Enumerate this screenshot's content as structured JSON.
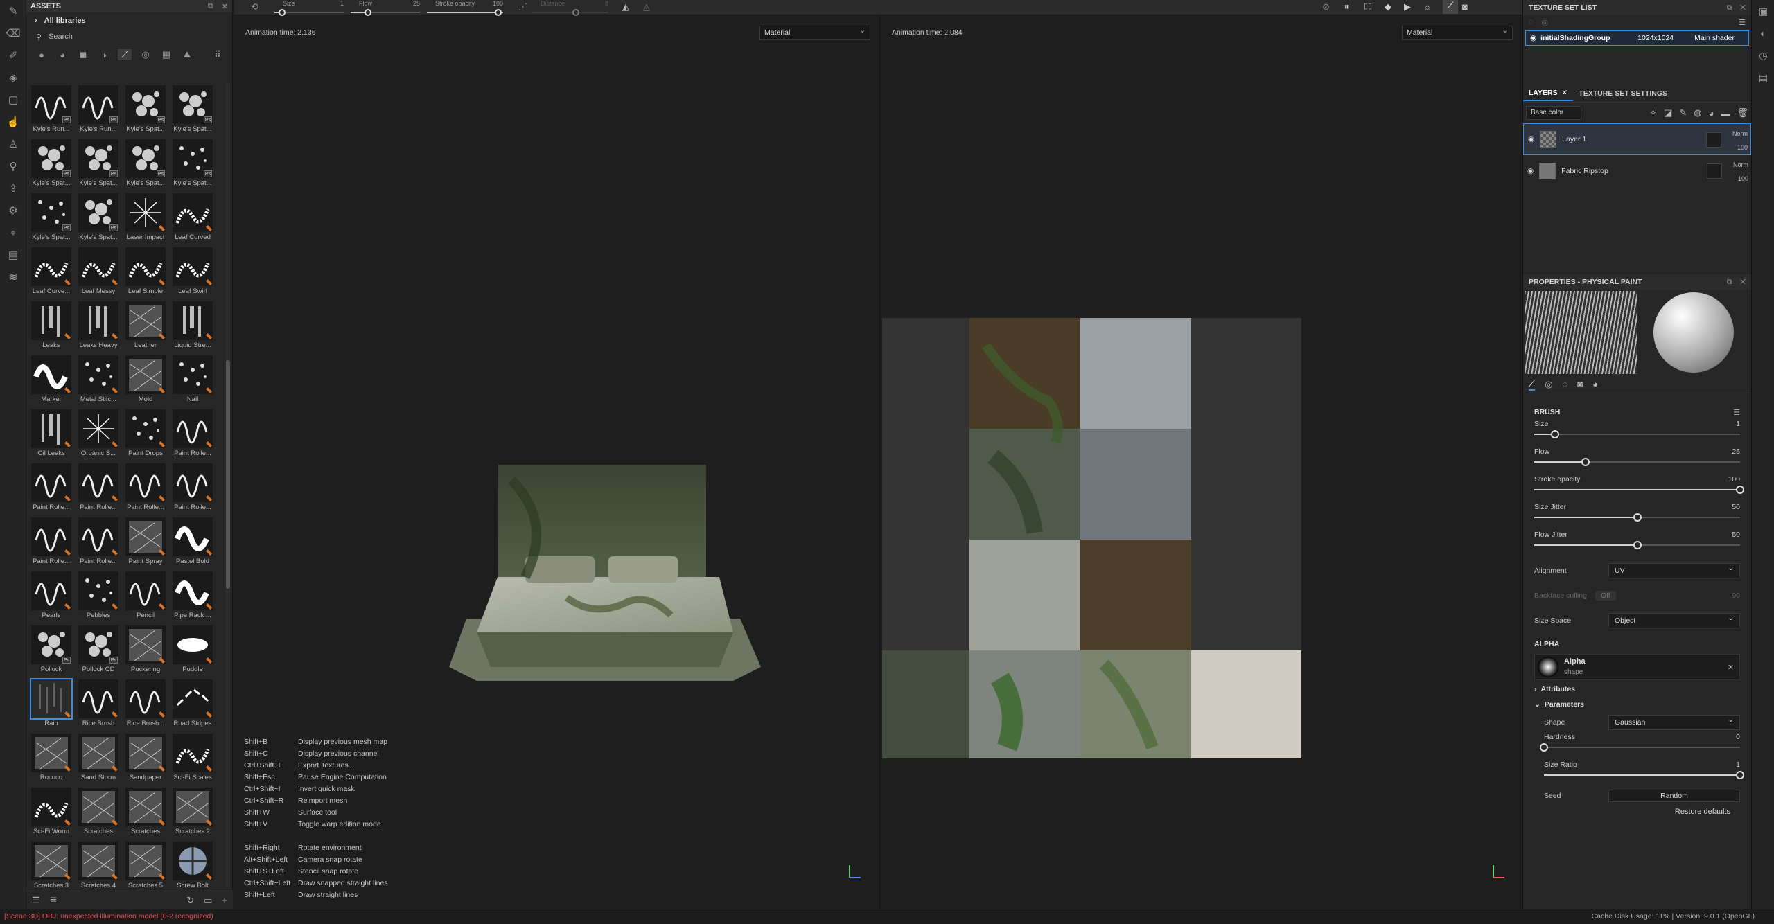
{
  "assets": {
    "title": "ASSETS",
    "library": "All libraries",
    "search_placeholder": "Search",
    "items": [
      {
        "label": "Kyle's Run...",
        "kind": "stroke",
        "badge": "ps"
      },
      {
        "label": "Kyle's Run...",
        "kind": "stroke",
        "badge": "ps"
      },
      {
        "label": "Kyle's Spat...",
        "kind": "spatter",
        "badge": "ps"
      },
      {
        "label": "Kyle's Spat...",
        "kind": "spatter",
        "badge": "ps"
      },
      {
        "label": "Kyle's Spat...",
        "kind": "spatter",
        "badge": "ps"
      },
      {
        "label": "Kyle's Spat...",
        "kind": "spatter",
        "badge": "ps"
      },
      {
        "label": "Kyle's Spat...",
        "kind": "spatter",
        "badge": "ps"
      },
      {
        "label": "Kyle's Spat...",
        "kind": "dots",
        "badge": "ps"
      },
      {
        "label": "Kyle's Spat...",
        "kind": "dots",
        "badge": "ps"
      },
      {
        "label": "Kyle's Spat...",
        "kind": "spatter",
        "badge": "ps"
      },
      {
        "label": "Laser Impact",
        "kind": "star",
        "badge": "sp"
      },
      {
        "label": "Leaf Curved",
        "kind": "leaf",
        "badge": "sp"
      },
      {
        "label": "Leaf Curve...",
        "kind": "leaf",
        "badge": "sp"
      },
      {
        "label": "Leaf Messy",
        "kind": "leaf",
        "badge": "sp"
      },
      {
        "label": "Leaf Simple",
        "kind": "leaf",
        "badge": "sp"
      },
      {
        "label": "Leaf Swirl",
        "kind": "leaf",
        "badge": "sp"
      },
      {
        "label": "Leaks",
        "kind": "drip",
        "badge": "sp"
      },
      {
        "label": "Leaks Heavy",
        "kind": "drip",
        "badge": "sp"
      },
      {
        "label": "Leather",
        "kind": "texture",
        "badge": "sp"
      },
      {
        "label": "Liquid Stre...",
        "kind": "drip",
        "badge": "sp"
      },
      {
        "label": "Marker",
        "kind": "bold",
        "badge": "sp"
      },
      {
        "label": "Metal Stitc...",
        "kind": "dots",
        "badge": "sp"
      },
      {
        "label": "Mold",
        "kind": "texture",
        "badge": "sp"
      },
      {
        "label": "Nail",
        "kind": "dots",
        "badge": "sp"
      },
      {
        "label": "Oil Leaks",
        "kind": "drip",
        "badge": "sp"
      },
      {
        "label": "Organic S...",
        "kind": "star",
        "badge": "sp"
      },
      {
        "label": "Paint Drops",
        "kind": "dots",
        "badge": "sp"
      },
      {
        "label": "Paint Rolle...",
        "kind": "stroke",
        "badge": "sp"
      },
      {
        "label": "Paint Rolle...",
        "kind": "stroke",
        "badge": "sp"
      },
      {
        "label": "Paint Rolle...",
        "kind": "stroke",
        "badge": "sp"
      },
      {
        "label": "Paint Rolle...",
        "kind": "stroke",
        "badge": "sp"
      },
      {
        "label": "Paint Rolle...",
        "kind": "stroke",
        "badge": "sp"
      },
      {
        "label": "Paint Rolle...",
        "kind": "stroke",
        "badge": "sp"
      },
      {
        "label": "Paint Rolle...",
        "kind": "stroke",
        "badge": "sp"
      },
      {
        "label": "Paint Spray",
        "kind": "texture",
        "badge": "sp"
      },
      {
        "label": "Pastel Bold",
        "kind": "bold",
        "badge": "sp"
      },
      {
        "label": "Pearls",
        "kind": "stroke",
        "badge": "sp"
      },
      {
        "label": "Pebbles",
        "kind": "dots",
        "badge": "sp"
      },
      {
        "label": "Pencil",
        "kind": "stroke",
        "badge": "sp"
      },
      {
        "label": "Pipe Rack ...",
        "kind": "bold",
        "badge": "sp"
      },
      {
        "label": "Pollock",
        "kind": "spatter",
        "badge": "ps"
      },
      {
        "label": "Pollock CD",
        "kind": "spatter",
        "badge": "ps"
      },
      {
        "label": "Puckering",
        "kind": "texture",
        "badge": "sp"
      },
      {
        "label": "Puddle",
        "kind": "blob",
        "badge": "sp"
      },
      {
        "label": "Rain",
        "kind": "rain",
        "badge": "sp",
        "selected": true
      },
      {
        "label": "Rice Brush",
        "kind": "stroke",
        "badge": "sp"
      },
      {
        "label": "Rice Brush...",
        "kind": "stroke",
        "badge": "sp"
      },
      {
        "label": "Road Stripes",
        "kind": "dash",
        "badge": "sp"
      },
      {
        "label": "Rococo",
        "kind": "texture",
        "badge": "sp"
      },
      {
        "label": "Sand Storm",
        "kind": "texture",
        "badge": "sp"
      },
      {
        "label": "Sandpaper",
        "kind": "texture",
        "badge": "sp"
      },
      {
        "label": "Sci-Fi Scales",
        "kind": "leaf",
        "badge": "sp"
      },
      {
        "label": "Sci-Fi Worm",
        "kind": "leaf",
        "badge": "sp"
      },
      {
        "label": "Scratches",
        "kind": "texture",
        "badge": "sp"
      },
      {
        "label": "Scratches",
        "kind": "texture",
        "badge": "sp"
      },
      {
        "label": "Scratches 2",
        "kind": "texture",
        "badge": "sp"
      },
      {
        "label": "Scratches 3",
        "kind": "texture",
        "badge": "sp"
      },
      {
        "label": "Scratches 4",
        "kind": "texture",
        "badge": "sp"
      },
      {
        "label": "Scratches 5",
        "kind": "texture",
        "badge": "sp"
      },
      {
        "label": "Screw Bolt",
        "kind": "ball",
        "badge": "sp"
      }
    ]
  },
  "toolbar": {
    "size_label": "Size",
    "size_value": "1",
    "flow_label": "Flow",
    "flow_value": "25",
    "opacity_label": "Stroke opacity",
    "opacity_value": "100",
    "distance_label": "Distance",
    "distance_value": "8"
  },
  "viewport3d": {
    "anim_time": "Animation time: 2.136",
    "mode": "Material"
  },
  "viewport2d": {
    "anim_time": "Animation time: 2.084",
    "mode": "Material"
  },
  "shortcuts": [
    {
      "key": "Shift+B",
      "action": "Display previous mesh map"
    },
    {
      "key": "Shift+C",
      "action": "Display previous channel"
    },
    {
      "key": "Ctrl+Shift+E",
      "action": "Export Textures..."
    },
    {
      "key": "Shift+Esc",
      "action": "Pause Engine Computation"
    },
    {
      "key": "Ctrl+Shift+I",
      "action": "Invert quick mask"
    },
    {
      "key": "Ctrl+Shift+R",
      "action": "Reimport mesh"
    },
    {
      "key": "Shift+W",
      "action": "Surface tool"
    },
    {
      "key": "Shift+V",
      "action": "Toggle warp edition mode"
    },
    {
      "key": "",
      "action": ""
    },
    {
      "key": "Shift+Right",
      "action": "Rotate environment"
    },
    {
      "key": "Alt+Shift+Left",
      "action": "Camera snap rotate"
    },
    {
      "key": "Shift+S+Left",
      "action": "Stencil snap rotate"
    },
    {
      "key": "Ctrl+Shift+Left",
      "action": "Draw snapped straight lines"
    },
    {
      "key": "Shift+Left",
      "action": "Draw straight lines"
    }
  ],
  "texture_set_list": {
    "title": "TEXTURE SET LIST",
    "row": {
      "name": "initialShadingGroup",
      "resolution": "1024x1024",
      "shader": "Main shader"
    }
  },
  "layers": {
    "tab_layers": "LAYERS",
    "tab_settings": "TEXTURE SET SETTINGS",
    "channel": "Base color",
    "items": [
      {
        "name": "Layer 1",
        "blend": "Norm",
        "opacity": "100",
        "selected": true
      },
      {
        "name": "Fabric Ripstop",
        "blend": "Norm",
        "opacity": "100",
        "selected": false
      }
    ]
  },
  "properties": {
    "title": "PROPERTIES - PHYSICAL PAINT",
    "brush_title": "BRUSH",
    "sliders": [
      {
        "label": "Size",
        "value": "1",
        "pct": 0.1
      },
      {
        "label": "Flow",
        "value": "25",
        "pct": 0.25
      },
      {
        "label": "Stroke opacity",
        "value": "100",
        "pct": 1.0
      },
      {
        "label": "Size Jitter",
        "value": "50",
        "pct": 0.5
      },
      {
        "label": "Flow Jitter",
        "value": "50",
        "pct": 0.5
      }
    ],
    "alignment_label": "Alignment",
    "alignment_value": "UV",
    "backface_label": "Backface culling",
    "backface_value": "Off",
    "backface_num": "90",
    "sizespace_label": "Size Space",
    "sizespace_value": "Object",
    "alpha_title": "ALPHA",
    "alpha_name": "Alpha",
    "alpha_sub": "shape",
    "attributes": "Attributes",
    "parameters": "Parameters",
    "shape_label": "Shape",
    "shape_value": "Gaussian",
    "hardness_label": "Hardness",
    "hardness_value": "0",
    "sizeratio_label": "Size Ratio",
    "sizeratio_value": "1",
    "seed_label": "Seed",
    "seed_value": "Random",
    "restore": "Restore defaults"
  },
  "status": {
    "error": "[Scene 3D] OBJ: unexpected illumination model (0-2 recognized)",
    "right": "Cache Disk Usage:   11% | Version: 9.0.1 (OpenGL)"
  }
}
